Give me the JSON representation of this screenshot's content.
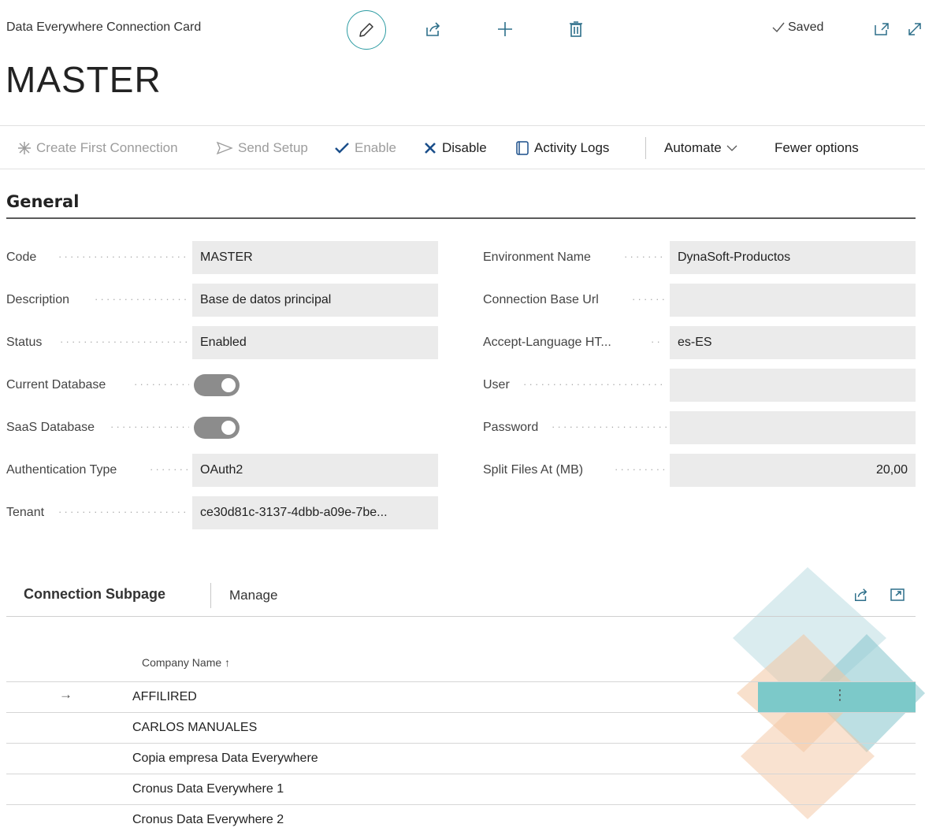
{
  "header": {
    "caption": "Data Everywhere Connection Card",
    "saved_label": "Saved",
    "title": "MASTER"
  },
  "actions": {
    "create_first_connection": "Create First Connection",
    "send_setup": "Send Setup",
    "enable": "Enable",
    "disable": "Disable",
    "activity_logs": "Activity Logs",
    "automate": "Automate",
    "fewer_options": "Fewer options"
  },
  "general": {
    "title": "General",
    "left": [
      {
        "label": "Code",
        "value": "MASTER"
      },
      {
        "label": "Description",
        "value": "Base de datos principal"
      },
      {
        "label": "Status",
        "value": "Enabled"
      },
      {
        "label": "Current Database",
        "toggle": true
      },
      {
        "label": "SaaS Database",
        "toggle": true
      },
      {
        "label": "Authentication Type",
        "value": "OAuth2"
      },
      {
        "label": "Tenant",
        "value": "ce30d81c-3137-4dbb-a09e-7be..."
      }
    ],
    "right": [
      {
        "label": "Environment Name",
        "value": "DynaSoft-Productos"
      },
      {
        "label": "Connection Base Url",
        "value": ""
      },
      {
        "label": "Accept-Language HT...",
        "value": "es-ES"
      },
      {
        "label": "User",
        "value": ""
      },
      {
        "label": "Password",
        "value": ""
      },
      {
        "label": "Split Files At (MB)",
        "value": "20,00"
      }
    ]
  },
  "subpage": {
    "title": "Connection Subpage",
    "manage": "Manage",
    "column_header": "Company Name ↑",
    "rows": [
      "AFFILIRED",
      "CARLOS MANUALES",
      "Copia empresa Data Everywhere",
      "Cronus Data Everywhere 1",
      "Cronus Data Everywhere 2"
    ]
  },
  "colors": {
    "accent": "#2d9ca3",
    "field_bg": "#ebebeb",
    "toggle_on": "#8c8c8c",
    "selected_row": "#7cc9c9"
  }
}
